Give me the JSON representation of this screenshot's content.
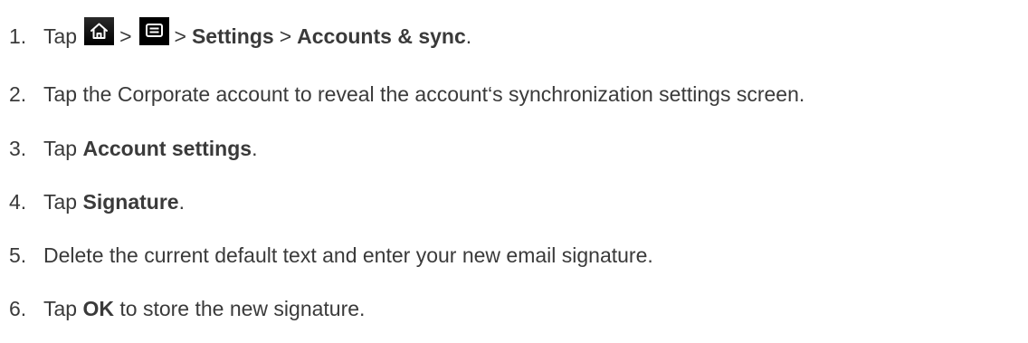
{
  "steps": [
    {
      "num": "1.",
      "tap": "Tap",
      "sep1": ">",
      "sep2": ">",
      "settings": "Settings",
      "sep3": ">",
      "accounts": "Accounts & sync",
      "end": ".",
      "icons": [
        "home-icon",
        "menu-icon"
      ]
    },
    {
      "num": "2.",
      "text": "Tap the Corporate account to reveal the account‘s synchronization settings screen."
    },
    {
      "num": "3.",
      "pre": "Tap ",
      "bold": "Account settings",
      "post": "."
    },
    {
      "num": "4.",
      "pre": "Tap ",
      "bold": "Signature",
      "post": "."
    },
    {
      "num": "5.",
      "text": "Delete the current default text and enter your new email signature."
    },
    {
      "num": "6.",
      "pre": "Tap ",
      "bold": "OK",
      "post": " to store the new signature."
    }
  ]
}
